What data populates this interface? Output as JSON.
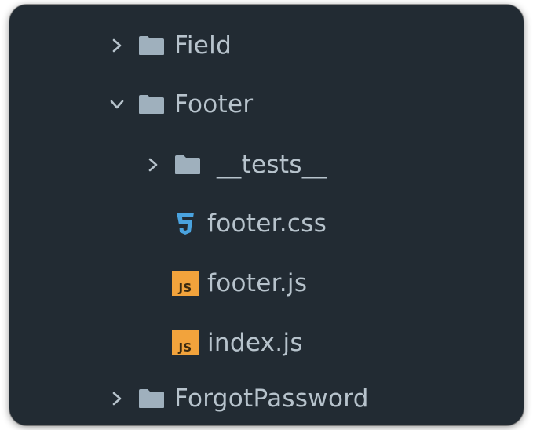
{
  "tree": {
    "items": [
      {
        "label": "Field",
        "kind": "folder",
        "expanded": false
      },
      {
        "label": "Footer",
        "kind": "folder",
        "expanded": true
      },
      {
        "label": "__tests__",
        "kind": "folder",
        "expanded": false
      },
      {
        "label": "footer.css",
        "kind": "css-file",
        "icon": "css3-icon"
      },
      {
        "label": "footer.js",
        "kind": "js-file",
        "icon": "js-file-icon",
        "badge": "JS"
      },
      {
        "label": "index.js",
        "kind": "js-file",
        "icon": "js-file-icon",
        "badge": "JS"
      },
      {
        "label": "ForgotPassword",
        "kind": "folder",
        "expanded": false
      }
    ]
  },
  "colors": {
    "background": "#222b33",
    "text": "#b7c3cc",
    "folder": "#9fb0bd",
    "chevron": "#b7c3cc",
    "css_icon": "#4aa3df",
    "js_badge": "#f2a33c"
  }
}
